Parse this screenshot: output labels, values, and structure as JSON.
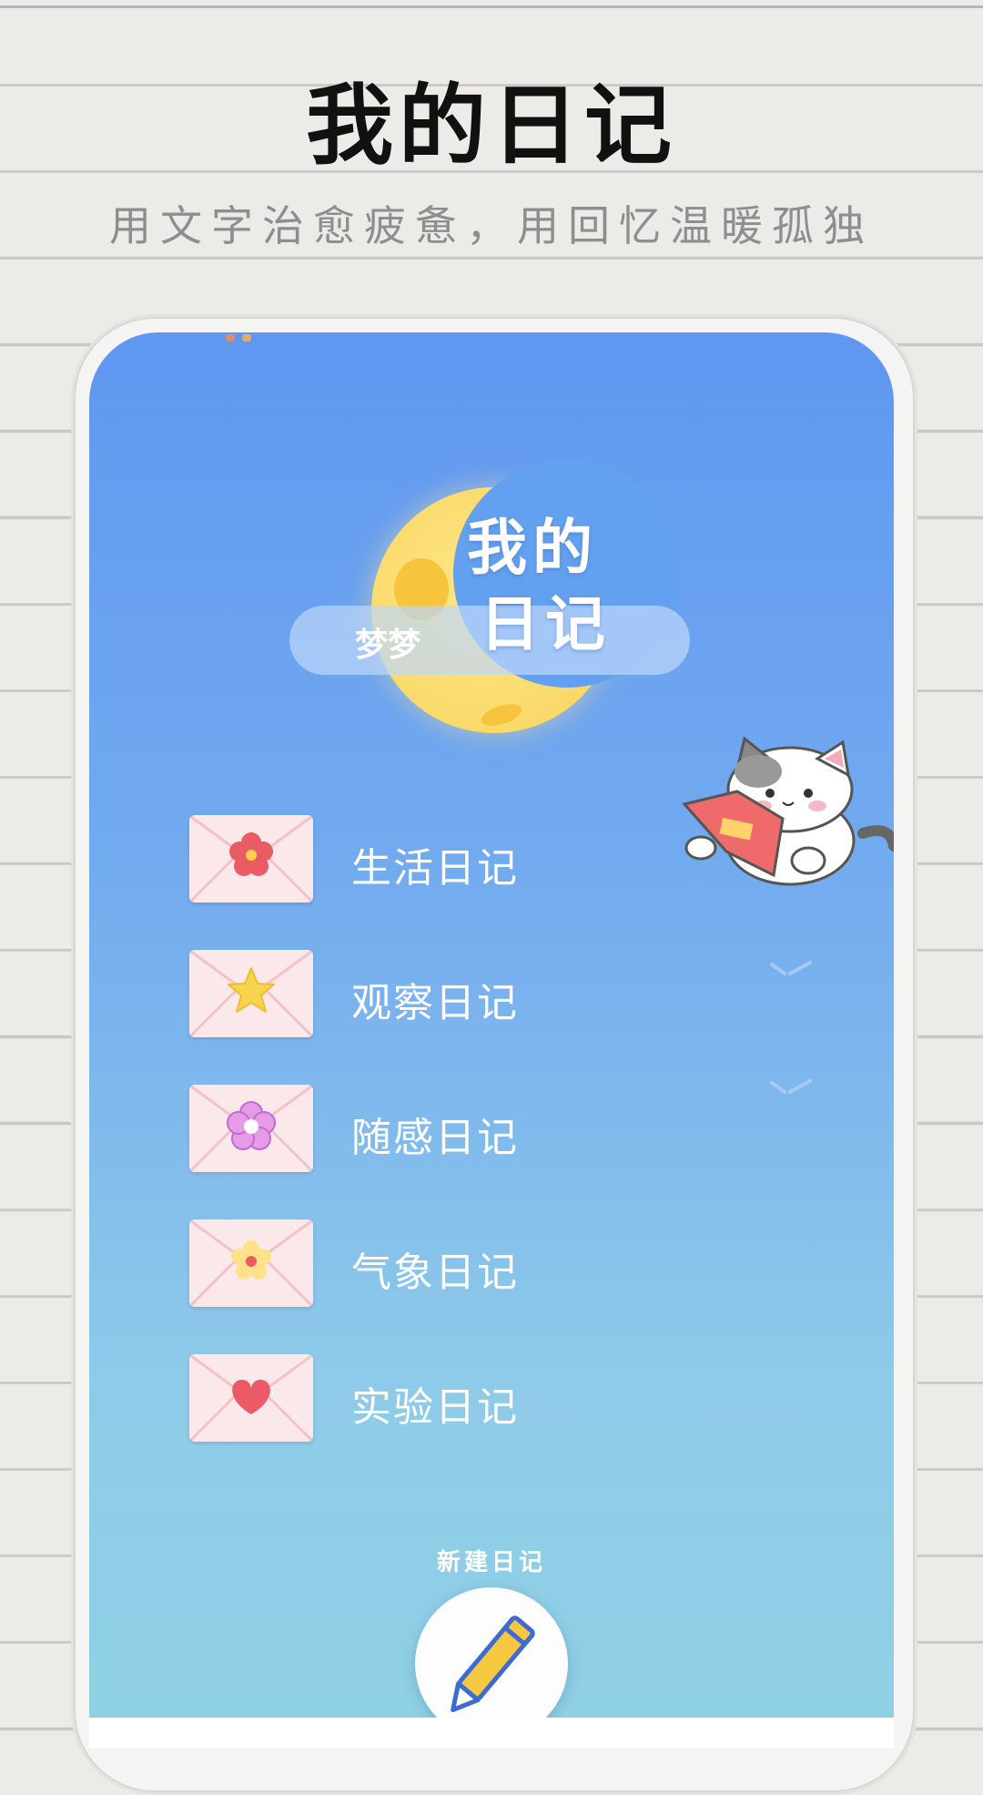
{
  "header": {
    "title": "我的日记",
    "subtitle": "用文字治愈疲惫，用回忆温暖孤独"
  },
  "app": {
    "logo_text_line1": "我的",
    "logo_text_line2": "日记",
    "user_name": "梦梦",
    "diaries": [
      {
        "label": "生活日记",
        "icon": "flower-icon"
      },
      {
        "label": "观察日记",
        "icon": "star-icon"
      },
      {
        "label": "随感日记",
        "icon": "pink-flower-icon"
      },
      {
        "label": "气象日记",
        "icon": "sun-flower-icon"
      },
      {
        "label": "实验日记",
        "icon": "heart-icon"
      }
    ],
    "new_diary_label": "新建日记",
    "new_diary_icon": "pencil-icon"
  },
  "colors": {
    "screen_top": "#5f97f1",
    "screen_bottom": "#8fd1e4",
    "moon": "#f7d35b",
    "envelope": "#fbe8ea"
  }
}
